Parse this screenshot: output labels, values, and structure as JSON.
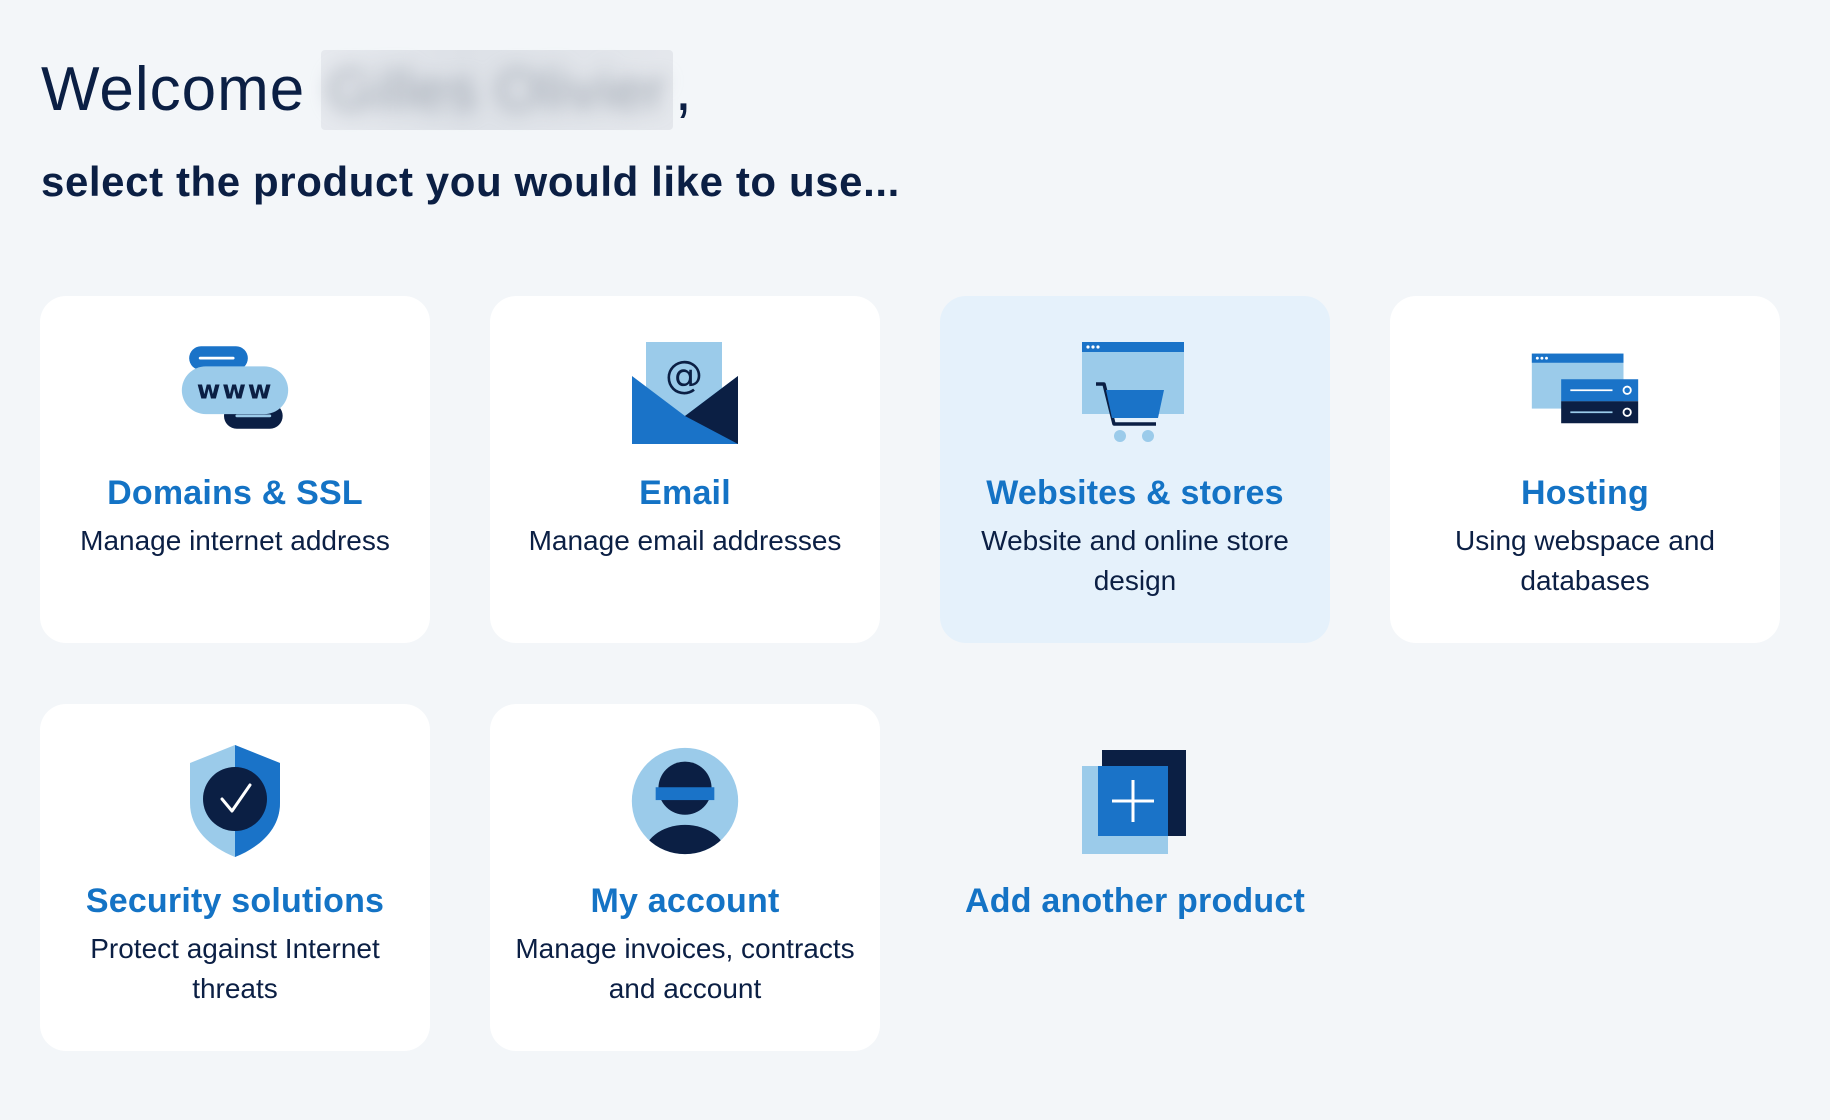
{
  "header": {
    "welcome": "Welcome",
    "user_name": "Gilles Olivier",
    "comma": ",",
    "subtitle": "select the product you would like to use..."
  },
  "products": [
    {
      "icon": "www-domain-icon",
      "title": "Domains & SSL",
      "description": "Manage internet address"
    },
    {
      "icon": "envelope-at-icon",
      "title": "Email",
      "description": "Manage email addresses"
    },
    {
      "icon": "browser-cart-icon",
      "title": "Websites & stores",
      "description": "Website and online store design"
    },
    {
      "icon": "server-stack-icon",
      "title": "Hosting",
      "description": "Using webspace and databases"
    },
    {
      "icon": "shield-check-icon",
      "title": "Security solutions",
      "description": "Protect against Internet threats"
    },
    {
      "icon": "user-avatar-icon",
      "title": "My account",
      "description": "Manage invoices, contracts and account"
    },
    {
      "icon": "add-square-icon",
      "title": "Add another product",
      "description": ""
    }
  ],
  "colors": {
    "background": "#f3f6f9",
    "card": "#ffffff",
    "card_highlight": "#e5f1fb",
    "title_blue": "#1473c5",
    "navy": "#0b1f44",
    "light_blue": "#9bcbea",
    "mid_blue": "#1a73c8"
  }
}
